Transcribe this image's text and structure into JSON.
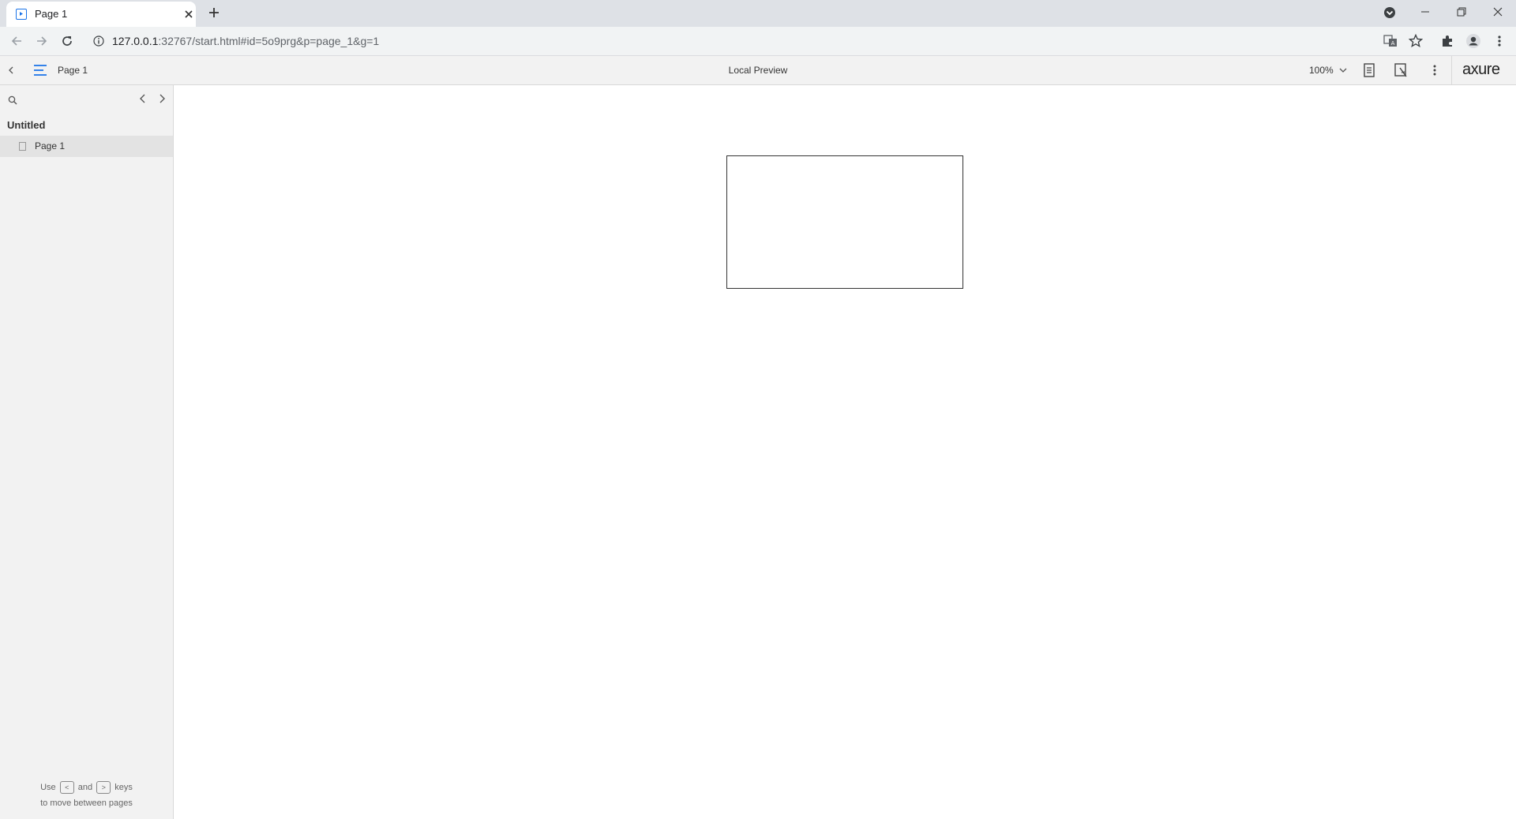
{
  "browser": {
    "tab_title": "Page 1",
    "url_host": "127.0.0.1",
    "url_rest": ":32767/start.html#id=5o9prg&p=page_1&g=1"
  },
  "axure": {
    "page_title": "Page 1",
    "preview_label": "Local Preview",
    "zoom": "100%",
    "logo": "axure"
  },
  "sidebar": {
    "project_title": "Untitled",
    "pages": [
      "Page 1"
    ],
    "hint_use": "Use",
    "hint_and": "and",
    "hint_keys": "keys",
    "hint_line2": "to move between pages"
  },
  "icons": {
    "favicon": "axure-preview-icon",
    "back": "arrow-left-icon",
    "forward": "arrow-right-icon",
    "reload": "reload-icon",
    "info": "info-icon",
    "translate": "translate-icon",
    "bookmark": "star-icon",
    "extensions": "puzzle-icon",
    "profile": "profile-icon",
    "menu": "kebab-menu-icon"
  }
}
